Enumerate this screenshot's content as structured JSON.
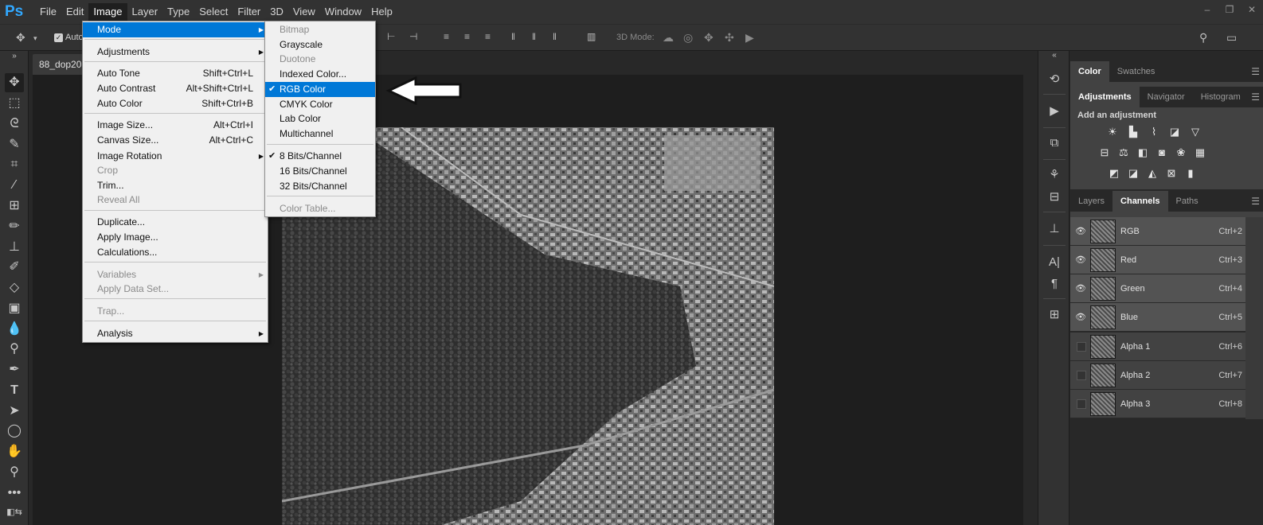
{
  "app": {
    "logo": "Ps"
  },
  "menubar": {
    "items": [
      "File",
      "Edit",
      "Image",
      "Layer",
      "Type",
      "Select",
      "Filter",
      "3D",
      "View",
      "Window",
      "Help"
    ],
    "active": "Image",
    "window_controls": [
      "‒",
      "❐",
      "✕"
    ]
  },
  "options": {
    "auto_label": "Auto",
    "three_d_mode": "3D Mode:"
  },
  "document": {
    "tab_title": "88_dop20rg"
  },
  "image_menu": {
    "items": [
      {
        "label": "Mode",
        "shortcut": "",
        "submenu": true,
        "highlight": true,
        "disabled": false
      },
      {
        "label": "Adjustments",
        "shortcut": "",
        "submenu": true,
        "highlight": false,
        "disabled": false
      },
      {
        "label": "Auto Tone",
        "shortcut": "Shift+Ctrl+L",
        "submenu": false,
        "highlight": false,
        "disabled": false
      },
      {
        "label": "Auto Contrast",
        "shortcut": "Alt+Shift+Ctrl+L",
        "submenu": false,
        "highlight": false,
        "disabled": false
      },
      {
        "label": "Auto Color",
        "shortcut": "Shift+Ctrl+B",
        "submenu": false,
        "highlight": false,
        "disabled": false
      },
      {
        "label": "Image Size...",
        "shortcut": "Alt+Ctrl+I",
        "submenu": false,
        "highlight": false,
        "disabled": false
      },
      {
        "label": "Canvas Size...",
        "shortcut": "Alt+Ctrl+C",
        "submenu": false,
        "highlight": false,
        "disabled": false
      },
      {
        "label": "Image Rotation",
        "shortcut": "",
        "submenu": true,
        "highlight": false,
        "disabled": false
      },
      {
        "label": "Crop",
        "shortcut": "",
        "submenu": false,
        "highlight": false,
        "disabled": true
      },
      {
        "label": "Trim...",
        "shortcut": "",
        "submenu": false,
        "highlight": false,
        "disabled": false
      },
      {
        "label": "Reveal All",
        "shortcut": "",
        "submenu": false,
        "highlight": false,
        "disabled": true
      },
      {
        "label": "Duplicate...",
        "shortcut": "",
        "submenu": false,
        "highlight": false,
        "disabled": false
      },
      {
        "label": "Apply Image...",
        "shortcut": "",
        "submenu": false,
        "highlight": false,
        "disabled": false
      },
      {
        "label": "Calculations...",
        "shortcut": "",
        "submenu": false,
        "highlight": false,
        "disabled": false
      },
      {
        "label": "Variables",
        "shortcut": "",
        "submenu": true,
        "highlight": false,
        "disabled": true
      },
      {
        "label": "Apply Data Set...",
        "shortcut": "",
        "submenu": false,
        "highlight": false,
        "disabled": true
      },
      {
        "label": "Trap...",
        "shortcut": "",
        "submenu": false,
        "highlight": false,
        "disabled": true
      },
      {
        "label": "Analysis",
        "shortcut": "",
        "submenu": true,
        "highlight": false,
        "disabled": false
      }
    ]
  },
  "mode_menu": {
    "items": [
      {
        "label": "Bitmap",
        "checked": false,
        "highlight": false,
        "disabled": true
      },
      {
        "label": "Grayscale",
        "checked": false,
        "highlight": false,
        "disabled": false
      },
      {
        "label": "Duotone",
        "checked": false,
        "highlight": false,
        "disabled": true
      },
      {
        "label": "Indexed Color...",
        "checked": false,
        "highlight": false,
        "disabled": false
      },
      {
        "label": "RGB Color",
        "checked": true,
        "highlight": true,
        "disabled": false
      },
      {
        "label": "CMYK Color",
        "checked": false,
        "highlight": false,
        "disabled": false
      },
      {
        "label": "Lab Color",
        "checked": false,
        "highlight": false,
        "disabled": false
      },
      {
        "label": "Multichannel",
        "checked": false,
        "highlight": false,
        "disabled": false
      },
      {
        "label": "8 Bits/Channel",
        "checked": true,
        "highlight": false,
        "disabled": false
      },
      {
        "label": "16 Bits/Channel",
        "checked": false,
        "highlight": false,
        "disabled": false
      },
      {
        "label": "32 Bits/Channel",
        "checked": false,
        "highlight": false,
        "disabled": false
      },
      {
        "label": "Color Table...",
        "checked": false,
        "highlight": false,
        "disabled": true
      }
    ]
  },
  "panels": {
    "color_tabs": [
      "Color",
      "Swatches"
    ],
    "adjust_tabs": [
      "Adjustments",
      "Navigator",
      "Histogram"
    ],
    "adjust_title": "Add an adjustment",
    "layer_tabs": [
      "Layers",
      "Channels",
      "Paths"
    ],
    "channels": [
      {
        "name": "RGB",
        "shortcut": "Ctrl+2",
        "visible": true
      },
      {
        "name": "Red",
        "shortcut": "Ctrl+3",
        "visible": true
      },
      {
        "name": "Green",
        "shortcut": "Ctrl+4",
        "visible": true
      },
      {
        "name": "Blue",
        "shortcut": "Ctrl+5",
        "visible": true
      },
      {
        "name": "Alpha 1",
        "shortcut": "Ctrl+6",
        "visible": false
      },
      {
        "name": "Alpha 2",
        "shortcut": "Ctrl+7",
        "visible": false
      },
      {
        "name": "Alpha 3",
        "shortcut": "Ctrl+8",
        "visible": false
      }
    ]
  },
  "colors": {
    "highlight": "#0078d7",
    "accent": "#31a8ff"
  }
}
